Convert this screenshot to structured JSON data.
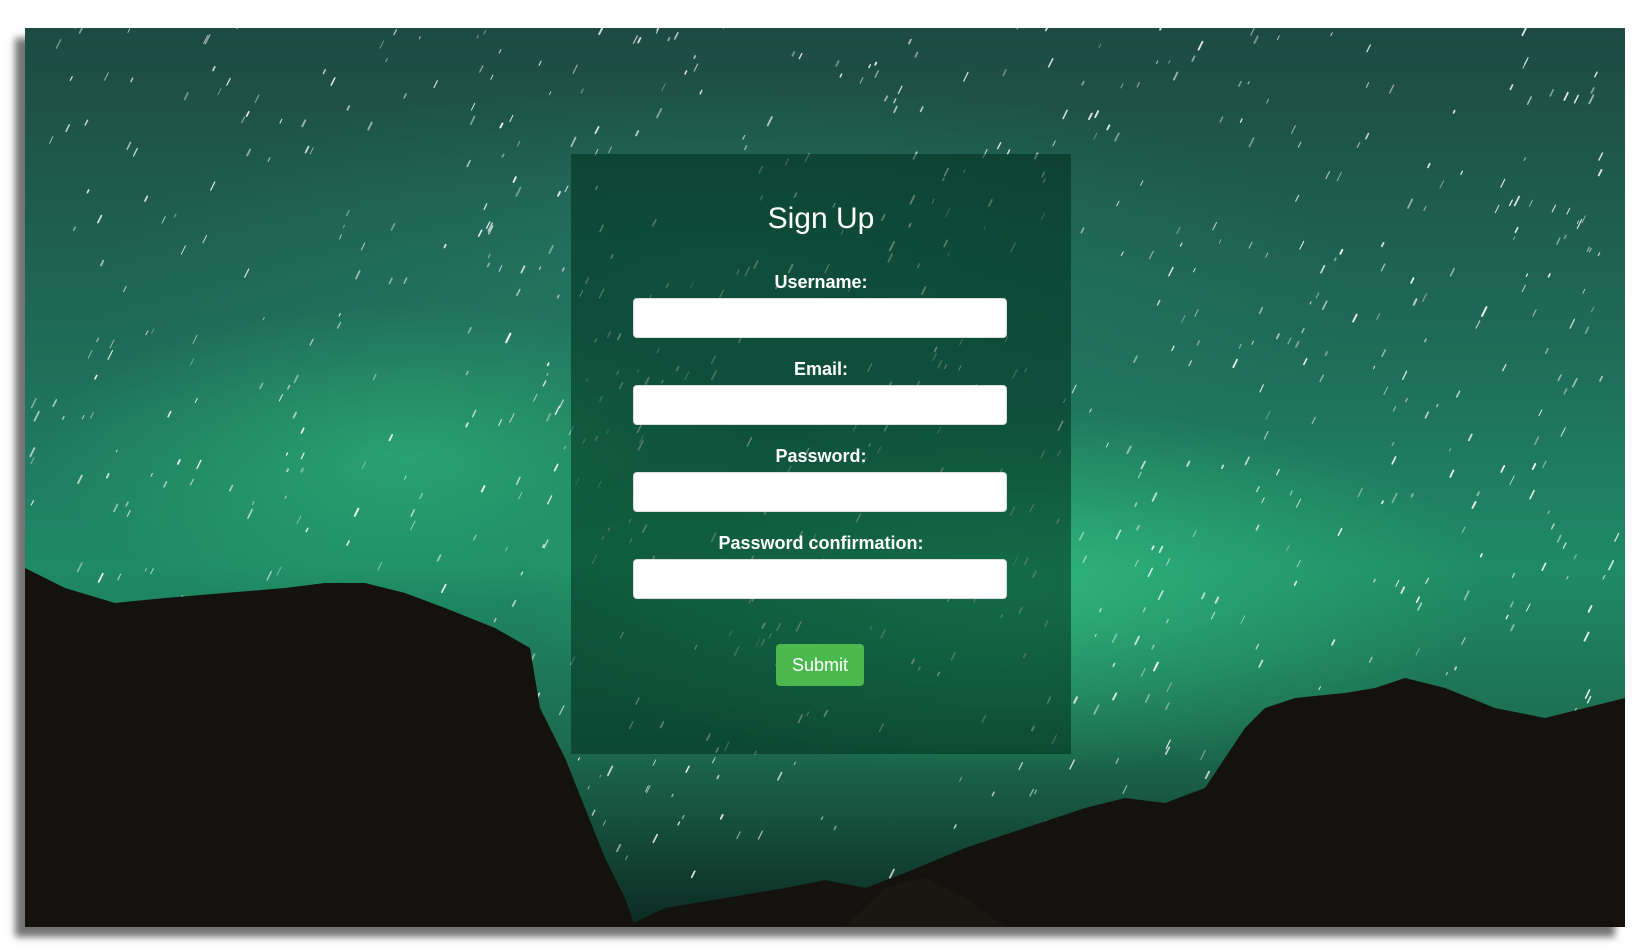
{
  "form": {
    "title": "Sign Up",
    "fields": [
      {
        "label": "Username:",
        "value": "",
        "placeholder": ""
      },
      {
        "label": "Email:",
        "value": "",
        "placeholder": ""
      },
      {
        "label": "Password:",
        "value": "",
        "placeholder": ""
      },
      {
        "label": "Password confirmation:",
        "value": "",
        "placeholder": ""
      }
    ],
    "submit_label": "Submit"
  },
  "colors": {
    "submit_button": "#4cb94f",
    "card_background": "rgba(0,45,30,0.55)",
    "aurora_green": "#1f8a66"
  }
}
